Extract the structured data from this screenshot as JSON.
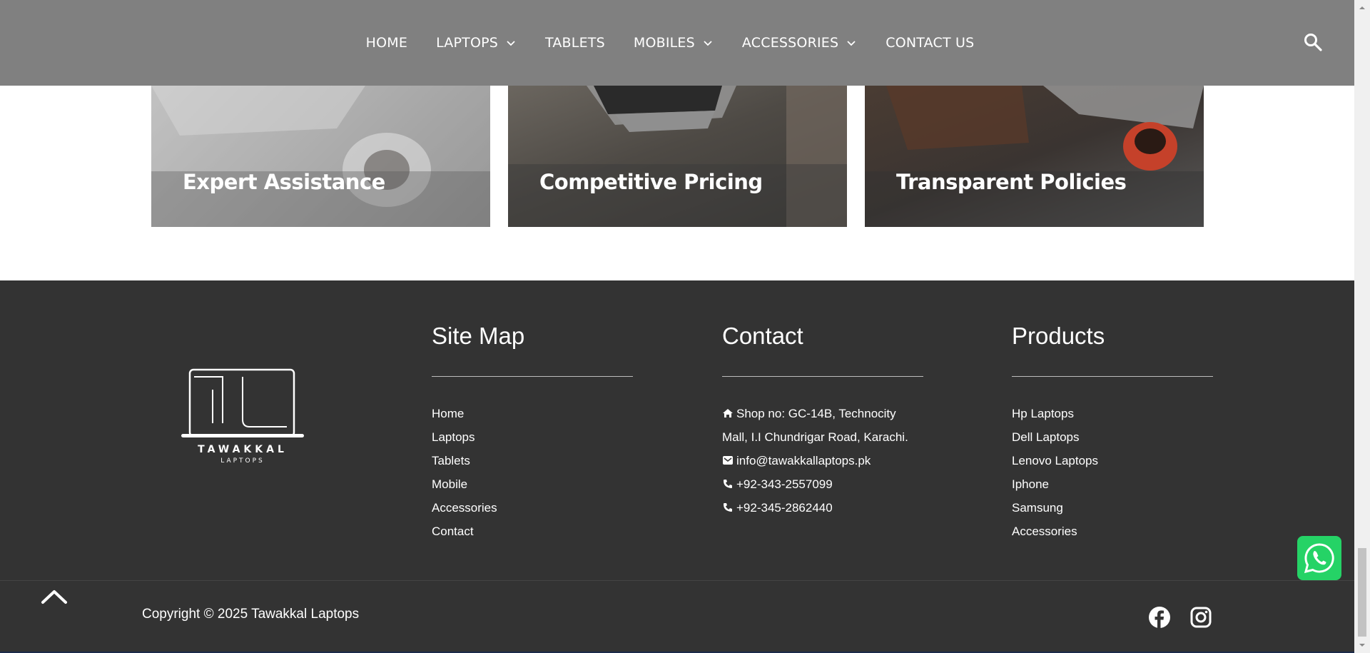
{
  "header": {
    "nav": [
      {
        "label": "HOME",
        "dropdown": false
      },
      {
        "label": "LAPTOPS",
        "dropdown": true
      },
      {
        "label": "TABLETS",
        "dropdown": false
      },
      {
        "label": "MOBILES",
        "dropdown": true
      },
      {
        "label": "ACCESSORIES",
        "dropdown": true
      },
      {
        "label": "CONTACT US",
        "dropdown": false
      }
    ],
    "search_icon": "search-icon"
  },
  "features": [
    {
      "title": "Expert Assistance"
    },
    {
      "title": "Competitive Pricing"
    },
    {
      "title": "Transparent Policies"
    }
  ],
  "footer": {
    "logo": {
      "brand": "TAWAKKAL",
      "tagline": "LAPTOPS"
    },
    "sitemap": {
      "title": "Site Map",
      "links": [
        "Home",
        "Laptops",
        "Tablets",
        "Mobile",
        "Accessories",
        "Contact"
      ]
    },
    "contact": {
      "title": "Contact",
      "address_line1": "Shop no: GC-14B, Technocity",
      "address_line2": "Mall, I.I Chundrigar Road, Karachi.",
      "email": "info@tawakkallaptops.pk",
      "phone1": "+92-343-2557099",
      "phone2": "+92-345-2862440"
    },
    "products": {
      "title": "Products",
      "links": [
        "Hp Laptops",
        "Dell Laptops",
        "Lenovo Laptops",
        "Iphone",
        "Samsung",
        "Accessories"
      ]
    },
    "copyright": "Copyright © 2025 Tawakkal Laptops",
    "social": [
      "facebook-icon",
      "instagram-icon"
    ]
  },
  "colors": {
    "header_bg": "#808080",
    "footer_bg": "#333333",
    "whatsapp": "#25d366"
  }
}
